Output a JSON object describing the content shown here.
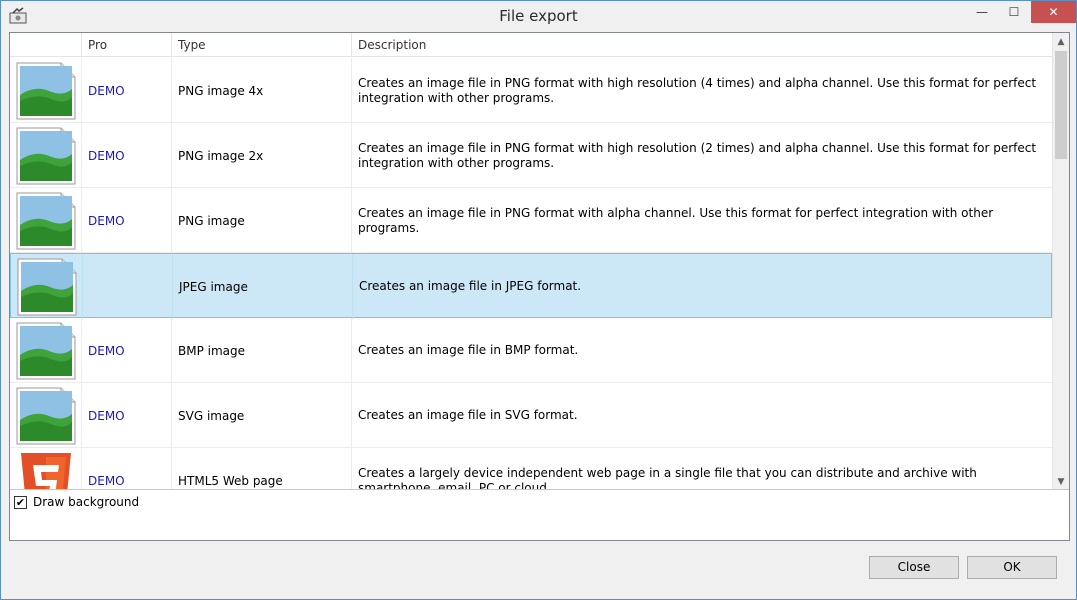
{
  "window": {
    "title": "File export",
    "controls": {
      "minimize": "—",
      "maximize": "☐",
      "close": "✕"
    }
  },
  "table": {
    "columns": {
      "icon": "",
      "pro": "Pro",
      "type": "Type",
      "description": "Description"
    },
    "rows": [
      {
        "icon": "image-file-icon",
        "pro": "DEMO",
        "type": "PNG image 4x",
        "description": "Creates an image file in PNG format with high resolution (4 times) and alpha channel. Use this format for perfect integration with other programs."
      },
      {
        "icon": "image-file-icon",
        "pro": "DEMO",
        "type": "PNG image 2x",
        "description": "Creates an image file in PNG format with high resolution (2 times) and alpha channel. Use this format for perfect integration with other programs."
      },
      {
        "icon": "image-file-icon",
        "pro": "DEMO",
        "type": "PNG image",
        "description": "Creates an image file in PNG format with alpha channel. Use this format for perfect integration with other programs."
      },
      {
        "icon": "image-file-icon",
        "pro": "",
        "type": "JPEG image",
        "description": "Creates an image file in JPEG format.",
        "selected": true
      },
      {
        "icon": "image-file-icon",
        "pro": "DEMO",
        "type": "BMP image",
        "description": "Creates an image file in BMP format."
      },
      {
        "icon": "image-file-icon",
        "pro": "DEMO",
        "type": "SVG image",
        "description": "Creates an image file in SVG format."
      },
      {
        "icon": "html5-icon",
        "pro": "DEMO",
        "type": "HTML5 Web page",
        "description": "Creates a largely device independent web page in a single file that you can distribute and archive with smartphone, email, PC or cloud."
      }
    ]
  },
  "options": {
    "draw_background": {
      "label": "Draw background",
      "checked": true
    }
  },
  "buttons": {
    "close": "Close",
    "ok": "OK"
  },
  "colors": {
    "accent": "#1a1ab3",
    "selection": "#cce8f6",
    "selection_border": "#7dc2e6"
  }
}
